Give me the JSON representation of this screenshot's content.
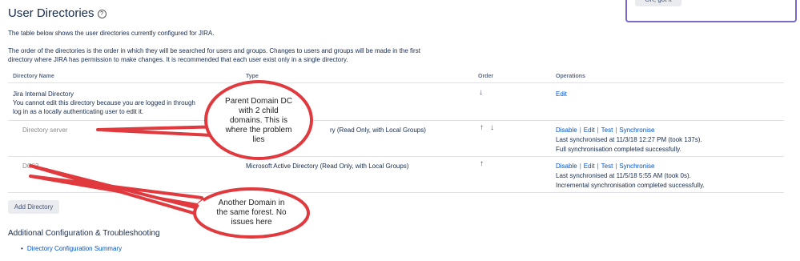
{
  "page": {
    "title": "User Directories",
    "help_icon": "question-circle-icon",
    "intro": "The table below shows the user directories currently configured for JIRA.",
    "order_text_1": "The order of the directories is the order in which they will be searched for users and groups. Changes to users and groups will be made in the first",
    "order_text_2": "directory where JIRA has permission to make changes. It is recommended that each user exist only in a single directory."
  },
  "tooltip": {
    "button_label": "OK, got it"
  },
  "table": {
    "headers": {
      "name": "Directory Name",
      "type": "Type",
      "order": "Order",
      "operations": "Operations"
    },
    "rows": [
      {
        "name": "Jira Internal Directory",
        "note_1": "You cannot edit this directory because you are logged in through",
        "note_2": "log in as a locally authenticating user to edit it.",
        "type": "",
        "ops": [
          "Edit"
        ],
        "status_1": "",
        "status_2": ""
      },
      {
        "name": "Directory server",
        "type": "ry (Read Only, with Local Groups)",
        "ops": [
          "Disable",
          "Edit",
          "Test",
          "Synchronise"
        ],
        "status_1": "Last synchronised at 11/3/18 12:27 PM (took 137s).",
        "status_2": "Full synchronisation completed successfully."
      },
      {
        "name": "DC03",
        "type": "Microsoft Active Directory (Read Only, with Local Groups)",
        "ops": [
          "Disable",
          "Edit",
          "Test",
          "Synchronise"
        ],
        "status_1": "Last synchronised at 11/5/18 5:55 AM (took 0s).",
        "status_2": "Incremental synchronisation completed successfully."
      }
    ]
  },
  "actions": {
    "add_directory": "Add Directory"
  },
  "additional": {
    "heading": "Additional Configuration & Troubleshooting",
    "link": "Directory Configuration Summary"
  },
  "callouts": {
    "first": [
      "Parent Domain DC",
      "with 2 child",
      "domains.  This is",
      "where the problem",
      "lies"
    ],
    "second": [
      "Another Domain in",
      "the same forest.  No",
      "issues here"
    ]
  },
  "colors": {
    "accent": "#0052cc",
    "callout_border": "#e0393e",
    "tooltip_border": "#7b69c9"
  }
}
